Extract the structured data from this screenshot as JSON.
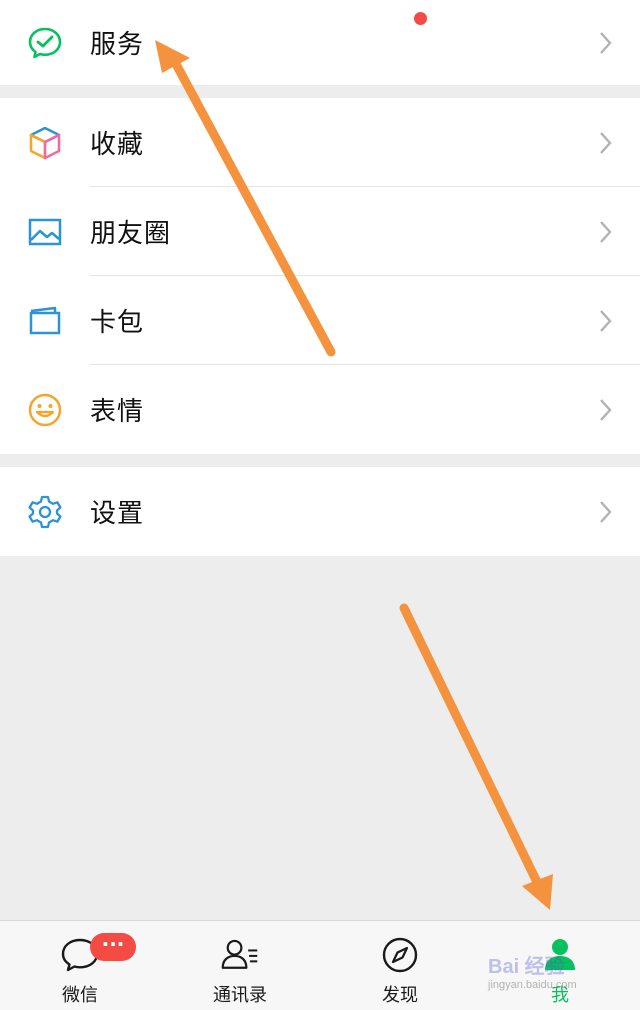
{
  "menu": {
    "service": {
      "label": "服务",
      "icon": "wechat-pay-icon",
      "color": "#07c160"
    },
    "favorites": {
      "label": "收藏",
      "icon": "cube-icon"
    },
    "moments": {
      "label": "朋友圈",
      "icon": "picture-icon",
      "color": "#2b93d6"
    },
    "cards": {
      "label": "卡包",
      "icon": "card-wallet-icon",
      "color": "#2b93d6"
    },
    "stickers": {
      "label": "表情",
      "icon": "smiley-icon",
      "color": "#f4a62a"
    },
    "settings": {
      "label": "设置",
      "icon": "gear-icon",
      "color": "#2b93d6"
    }
  },
  "tabbar": {
    "chats": {
      "label": "微信",
      "badge": "···"
    },
    "contacts": {
      "label": "通讯录"
    },
    "discover": {
      "label": "发现"
    },
    "me": {
      "label": "我"
    }
  },
  "annotation_color": "#f5923e",
  "accent": "#07c160",
  "watermark": {
    "main": "Bai 经验",
    "sub": "jingyan.baidu.com"
  }
}
